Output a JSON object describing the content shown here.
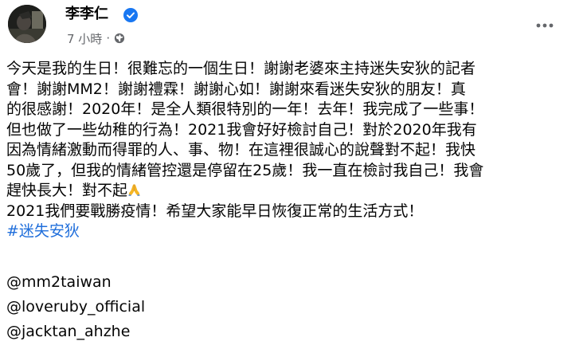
{
  "post": {
    "author_name": "李李仁",
    "time": "7 小時",
    "separator": "·",
    "audience_icon": "globe-icon",
    "more_icon": "ellipsis-icon",
    "verified_icon": "verified-badge-icon",
    "lines": [
      "今天是我的生日！很難忘的一個生日！謝謝老婆來主持迷失安狄的記者",
      "會！謝謝MM2！謝謝禮霖！謝謝心如！謝謝來看迷失安狄的朋友！真",
      "的很感謝！2020年！是全人類很特別的一年！去年！我完成了一些事！",
      "但也做了一些幼稚的行為！2021我會好好檢討自己！對於2020年我有",
      "因為情緒激動而得罪的人、事、物！在這裡很誠心的說聲對不起！我快",
      "50歲了，但我的情緒管控還是停留在25歲！我一直在檢討我自己！我會",
      "趕快長大！對不起",
      "2021我們要戰勝疫情！希望大家能早日恢復正常的生活方式！"
    ],
    "hashtag": "#迷失安狄",
    "mentions": [
      "@mm2taiwan",
      "@loveruby_official",
      "@jacktan_ahzhe"
    ]
  },
  "colors": {
    "text": "#050505",
    "secondary_text": "#65676b",
    "link": "#216fdb",
    "verified": "#1877f2"
  }
}
